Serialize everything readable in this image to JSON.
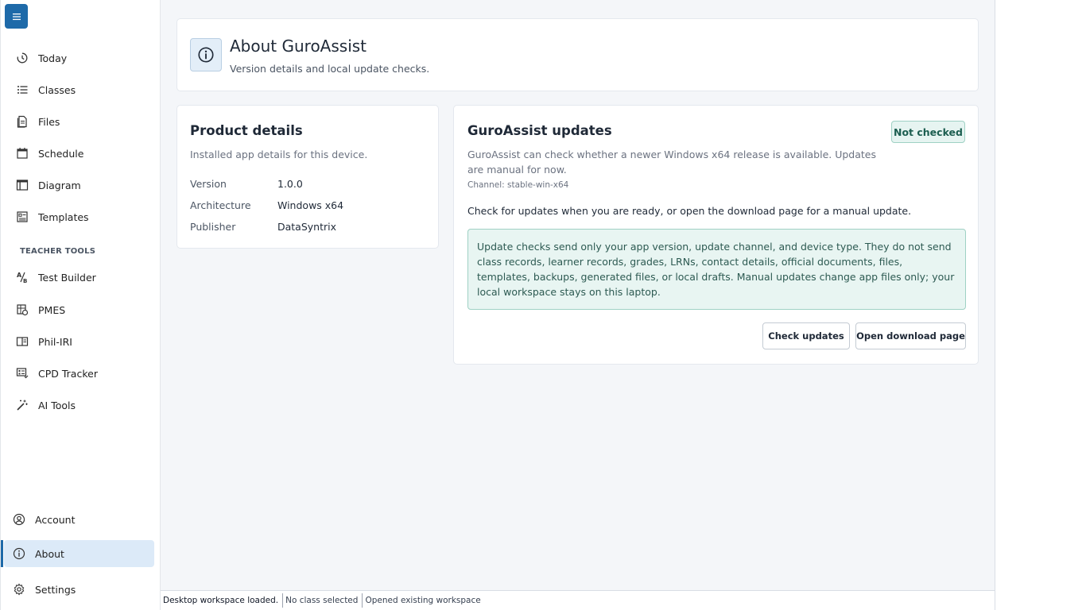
{
  "sidebar": {
    "menu_icon": "hamburger-icon",
    "items": [
      {
        "label": "Today",
        "icon": "clock-icon"
      },
      {
        "label": "Classes",
        "icon": "list-icon"
      },
      {
        "label": "Files",
        "icon": "file-icon"
      },
      {
        "label": "Schedule",
        "icon": "calendar-icon"
      },
      {
        "label": "Diagram",
        "icon": "layout-icon"
      },
      {
        "label": "Templates",
        "icon": "template-icon"
      }
    ],
    "section_label": "TEACHER TOOLS",
    "tools": [
      {
        "label": "Test Builder",
        "icon": "test-builder-icon"
      },
      {
        "label": "PMES",
        "icon": "pmes-icon"
      },
      {
        "label": "Phil-IRI",
        "icon": "book-icon"
      },
      {
        "label": "CPD Tracker",
        "icon": "tracker-icon"
      },
      {
        "label": "AI Tools",
        "icon": "magic-wand-icon"
      }
    ],
    "bottom": [
      {
        "label": "Account",
        "icon": "user-circle-icon"
      },
      {
        "label": "About",
        "icon": "info-icon",
        "active": true
      },
      {
        "label": "Settings",
        "icon": "gear-icon"
      }
    ]
  },
  "header": {
    "title": "About GuroAssist",
    "subtitle": "Version details and local update checks.",
    "icon": "info-icon"
  },
  "product": {
    "title": "Product details",
    "subtitle": "Installed app details for this device.",
    "rows": [
      {
        "key": "Version",
        "value": "1.0.0"
      },
      {
        "key": "Architecture",
        "value": "Windows x64"
      },
      {
        "key": "Publisher",
        "value": "DataSyntrix"
      }
    ]
  },
  "updates": {
    "title": "GuroAssist updates",
    "badge": "Not checked",
    "description": "GuroAssist can check whether a newer Windows x64 release is available. Updates are manual for now.",
    "channel": "Channel: stable-win-x64",
    "prompt": "Check for updates when you are ready, or open the download page for a manual update.",
    "notice": "Update checks send only your app version, update channel, and device type. They do not send class records, learner records, grades, LRNs, contact details, official documents, files, templates, backups, generated files, or local drafts. Manual updates change app files only; your local workspace stays on this laptop.",
    "check_button": "Check updates",
    "download_button": "Open download page"
  },
  "status": {
    "workspace": "Desktop workspace loaded.",
    "class": "No class selected",
    "info": "Opened existing workspace"
  },
  "colors": {
    "accent": "#1e6aa9",
    "active_bg": "#dceaf8",
    "notice_bg": "#e8f5f2",
    "notice_border": "#9fd1c4"
  }
}
